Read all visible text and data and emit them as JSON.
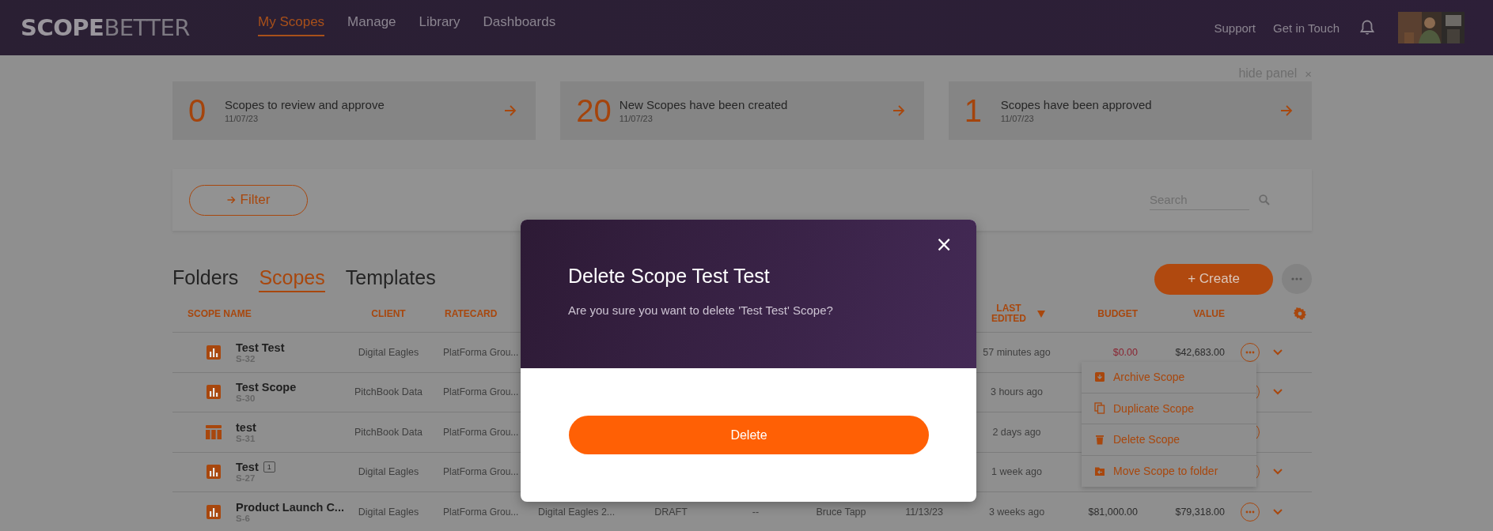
{
  "header": {
    "logo_primary": "SCOPE",
    "logo_secondary": "BETTER",
    "nav": [
      {
        "label": "My Scopes",
        "selected": true
      },
      {
        "label": "Manage",
        "selected": false
      },
      {
        "label": "Library",
        "selected": false
      },
      {
        "label": "Dashboards",
        "selected": false
      }
    ],
    "links": [
      "Support",
      "Get in Touch"
    ]
  },
  "panel": {
    "hide_label": "hide panel",
    "close": "×",
    "cards": [
      {
        "count": "0",
        "text": "Scopes to review and approve",
        "date": "11/07/23"
      },
      {
        "count": "20",
        "text": "New Scopes have been created",
        "date": "11/07/23"
      },
      {
        "count": "1",
        "text": "Scopes have been approved",
        "date": "11/07/23"
      }
    ]
  },
  "filter": {
    "label": "Filter",
    "search_placeholder": "Search"
  },
  "tabs": [
    {
      "label": "Folders",
      "selected": false
    },
    {
      "label": "Scopes",
      "selected": true
    },
    {
      "label": "Templates",
      "selected": false
    }
  ],
  "create_label": "+ Create",
  "table": {
    "columns": [
      {
        "label": "SCOPE NAME",
        "sorted_descending": false
      },
      {
        "label": "CLIENT",
        "sorted_descending": false
      },
      {
        "label": "RATECARD",
        "sorted_descending": false
      },
      {
        "label": "LAST EDITED",
        "sorted_descending": true
      },
      {
        "label": "BUDGET",
        "sorted_descending": false
      },
      {
        "label": "VALUE",
        "sorted_descending": false
      }
    ],
    "rows": [
      {
        "kind": "chart",
        "name": "Test Test",
        "code": "S-32",
        "client": "Digital Eagles",
        "ratecard": "PlatForma Grou...",
        "last_edited": "57 minutes ago",
        "budget": "$0.00",
        "budget_warning": true,
        "value": "$42,683.00",
        "expandable": true
      },
      {
        "kind": "chart",
        "name": "Test Scope",
        "code": "S-30",
        "client": "PitchBook Data",
        "ratecard": "PlatForma Grou...",
        "last_edited": "3 hours ago",
        "expandable": true
      },
      {
        "kind": "table",
        "name": "test",
        "code": "S-31",
        "client": "PitchBook Data",
        "ratecard": "PlatForma Grou...",
        "last_edited": "2 days ago",
        "expandable": false
      },
      {
        "kind": "chart",
        "name": "Test",
        "comments": "1",
        "code": "S-27",
        "client": "Digital Eagles",
        "ratecard": "PlatForma Grou...",
        "last_edited": "1 week ago",
        "expandable": true
      },
      {
        "kind": "chart",
        "name": "Product Launch C...",
        "code": "S-6",
        "client": "Digital Eagles",
        "ratecard": "PlatForma Grou...",
        "column_4": "Digital Eagles 2...",
        "column_5": "DRAFT",
        "column_6": "--",
        "column_7": "Bruce Tapp",
        "column_8": "11/13/23",
        "last_edited": "3 weeks ago",
        "budget": "$81,000.00",
        "budget_warning": false,
        "value": "$79,318.00",
        "expandable": true
      }
    ]
  },
  "context_menu": [
    {
      "kind": "archive",
      "label": "Archive Scope"
    },
    {
      "kind": "duplicate",
      "label": "Duplicate Scope"
    },
    {
      "kind": "delete",
      "label": "Delete Scope"
    },
    {
      "kind": "move",
      "label": "Move Scope to folder"
    }
  ],
  "dialog": {
    "title": "Delete Scope Test Test",
    "message": "Are you sure you want to delete 'Test Test' Scope?",
    "close": "×",
    "confirm": "Delete"
  }
}
